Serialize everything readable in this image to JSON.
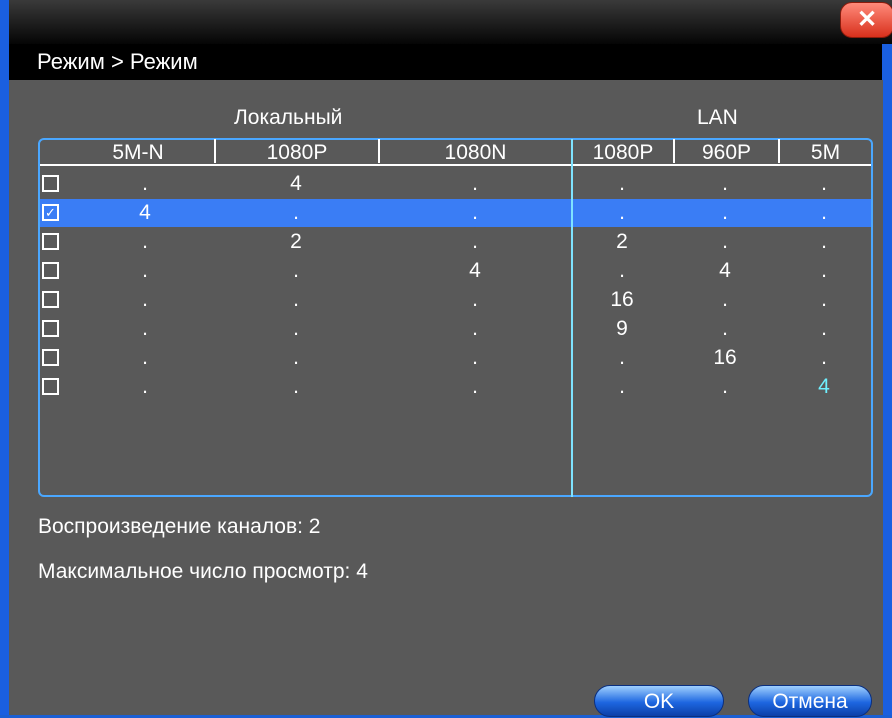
{
  "window": {
    "close_label": "✕"
  },
  "header": {
    "title": "Режим > Режим"
  },
  "groups": {
    "local": "Локальный",
    "lan": "LAN"
  },
  "columns": [
    "5M-N",
    "1080P",
    "1080N",
    "1080P",
    "960P",
    "5M"
  ],
  "rows": [
    {
      "checked": false,
      "selected": false,
      "values": [
        ".",
        "4",
        ".",
        ".",
        ".",
        "."
      ],
      "highlight_last": false
    },
    {
      "checked": true,
      "selected": true,
      "values": [
        "4",
        ".",
        ".",
        ".",
        ".",
        "."
      ],
      "highlight_last": false
    },
    {
      "checked": false,
      "selected": false,
      "values": [
        ".",
        "2",
        ".",
        "2",
        ".",
        "."
      ],
      "highlight_last": false
    },
    {
      "checked": false,
      "selected": false,
      "values": [
        ".",
        ".",
        "4",
        ".",
        "4",
        "."
      ],
      "highlight_last": false
    },
    {
      "checked": false,
      "selected": false,
      "values": [
        ".",
        ".",
        ".",
        "16",
        ".",
        "."
      ],
      "highlight_last": false
    },
    {
      "checked": false,
      "selected": false,
      "values": [
        ".",
        ".",
        ".",
        "9",
        ".",
        "."
      ],
      "highlight_last": false
    },
    {
      "checked": false,
      "selected": false,
      "values": [
        ".",
        ".",
        ".",
        ".",
        "16",
        "."
      ],
      "highlight_last": false
    },
    {
      "checked": false,
      "selected": false,
      "values": [
        ".",
        ".",
        ".",
        ".",
        ".",
        "4"
      ],
      "highlight_last": true
    }
  ],
  "info": {
    "playback": "Воспроизведение каналов: 2",
    "max_view": "Максимальное число просмотр: 4"
  },
  "buttons": {
    "ok": "OK",
    "cancel": "Отмена"
  },
  "colors": {
    "frame": "#1a5fe0",
    "panel": "#595959",
    "selected_row": "#3a7df5",
    "table_border": "#4aa7ff",
    "accent_cyan": "#6ff0ff"
  }
}
